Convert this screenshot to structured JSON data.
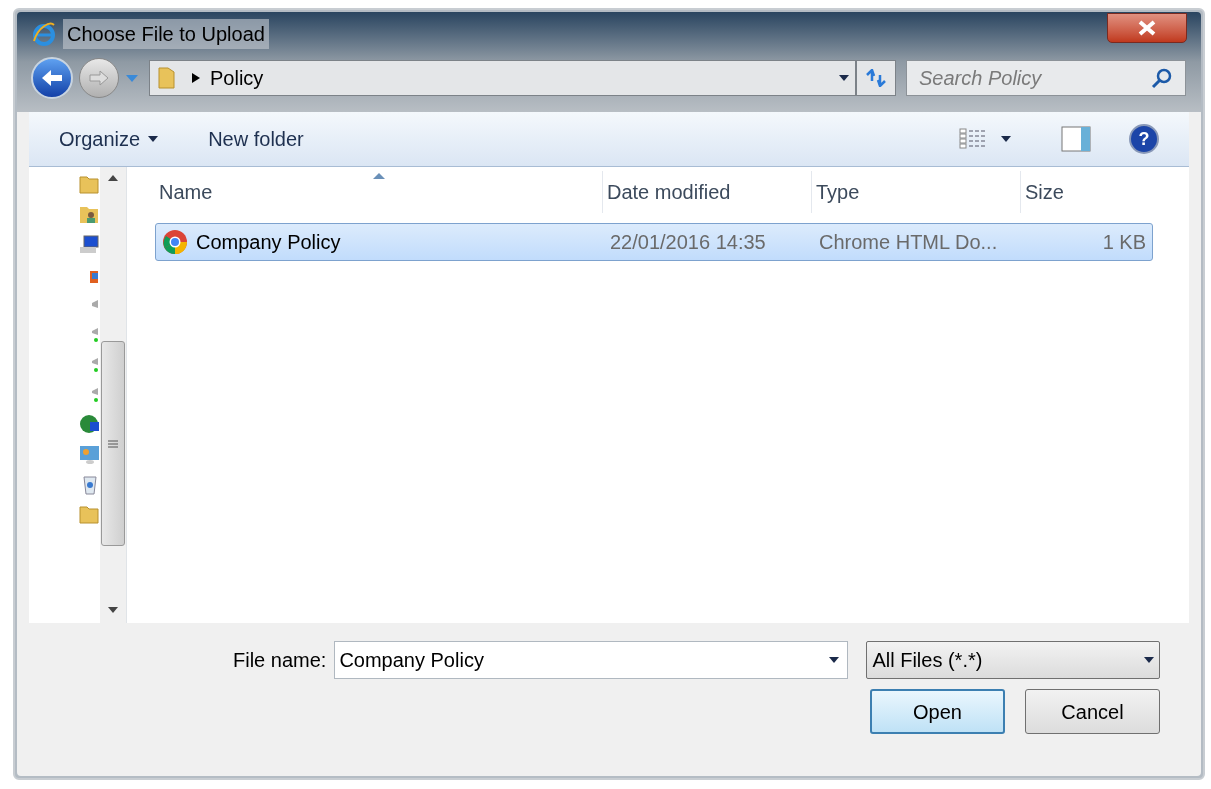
{
  "window": {
    "title": "Choose File to Upload"
  },
  "address": {
    "crumb": "Policy"
  },
  "search": {
    "placeholder": "Search Policy"
  },
  "toolbar": [
    {
      "label": "Organize",
      "kind": "menu"
    },
    {
      "label": "New folder",
      "kind": "button"
    }
  ],
  "help": {
    "glyph": "?"
  },
  "columns": [
    {
      "label": "Name",
      "sorted": true
    },
    {
      "label": "Date modified",
      "sorted": false
    },
    {
      "label": "Type",
      "sorted": false
    },
    {
      "label": "Size",
      "sorted": false
    }
  ],
  "rows": [
    {
      "name": "Company Policy",
      "date": "22/01/2016 14:35",
      "type": "Chrome HTML Do...",
      "size": "1 KB",
      "selected": true
    }
  ],
  "file_name": {
    "label": "File name:",
    "value": "Company Policy"
  },
  "filter": {
    "value": "All Files (*.*)"
  },
  "buttons": [
    {
      "label": "Open",
      "default": true
    },
    {
      "label": "Cancel",
      "default": false
    }
  ]
}
